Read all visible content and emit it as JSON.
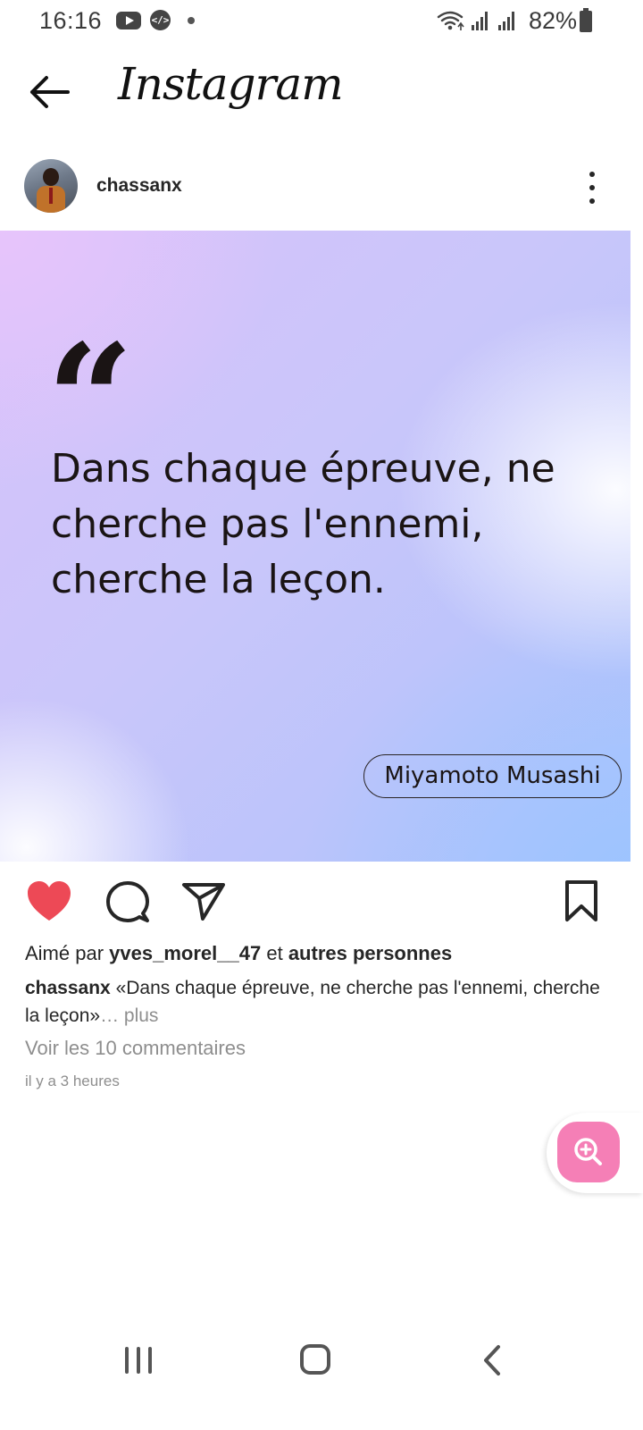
{
  "status_bar": {
    "time": "16:16",
    "battery": "82%",
    "icons": [
      "youtube-icon",
      "code-icon",
      "dot-icon",
      "wifi-icon",
      "signal-icon",
      "signal-icon",
      "battery-icon"
    ]
  },
  "header": {
    "title": "Instagram"
  },
  "post": {
    "username": "chassanx",
    "image": {
      "quote_mark": "“",
      "quote_text": "Dans chaque épreuve, ne cherche pas l'ennemi, cherche la leçon.",
      "author": "Miyamoto Musashi"
    },
    "liked": true,
    "like_color": "#ed4956",
    "likes": {
      "prefix": "Aimé par",
      "user": "yves_morel__47",
      "connector": "et",
      "others": "autres personnes"
    },
    "caption": {
      "user": "chassanx",
      "text": "«Dans chaque épreuve, ne cherche pas l'ennemi, cherche la leçon»",
      "more": "… plus"
    },
    "comments_link": "Voir les 10 commentaires",
    "time_ago": "il y a 3 heures"
  },
  "fab": {
    "icon": "zoom-in-icon",
    "color": "#f57fb6"
  }
}
